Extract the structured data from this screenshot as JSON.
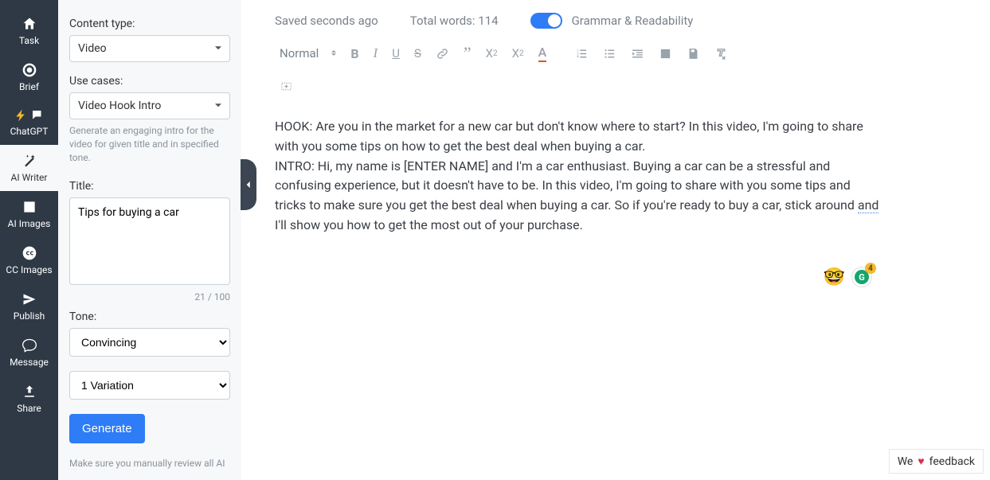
{
  "nav": {
    "items": [
      {
        "label": "Task"
      },
      {
        "label": "Brief"
      },
      {
        "label": "ChatGPT"
      },
      {
        "label": "AI Writer"
      },
      {
        "label": "AI Images"
      },
      {
        "label": "CC Images"
      },
      {
        "label": "Publish"
      },
      {
        "label": "Message"
      },
      {
        "label": "Share"
      }
    ]
  },
  "panel": {
    "content_type_label": "Content type:",
    "content_type_value": "Video",
    "use_cases_label": "Use cases:",
    "use_cases_value": "Video Hook Intro",
    "use_cases_helper": "Generate an engaging intro for the video for given title and in specified tone.",
    "title_label": "Title:",
    "title_value": "Tips for buying a car",
    "title_count": "21 / 100",
    "tone_label": "Tone:",
    "tone_value": "Convincing",
    "variation_value": "1 Variation",
    "generate_label": "Generate",
    "review_note": "Make sure you manually review all AI"
  },
  "status": {
    "saved": "Saved seconds ago",
    "words": "Total words: 114",
    "toggle_label": "Grammar & Readability"
  },
  "toolbar": {
    "format_label": "Normal"
  },
  "content": {
    "hook": "HOOK: Are you in the market for a new car but don't know where to start? In this video, I'm going to share with you some tips on how to get the best deal when buying a car.",
    "intro_pre": "INTRO: Hi, my name is [ENTER NAME] and I'm a car enthusiast. Buying a car can be a stressful and confusing experience, but it doesn't have to be. In this video, I'm going to share with you some tips and tricks to make sure you get the best deal when buying a car. So if you're ready to buy a car, stick around ",
    "intro_ul": "and",
    "intro_post": " I'll show you how to get the most out of your purchase."
  },
  "badges": {
    "g_count": "4"
  },
  "feedback": {
    "pre": "We ",
    "heart": "♥",
    "post": " feedback"
  }
}
